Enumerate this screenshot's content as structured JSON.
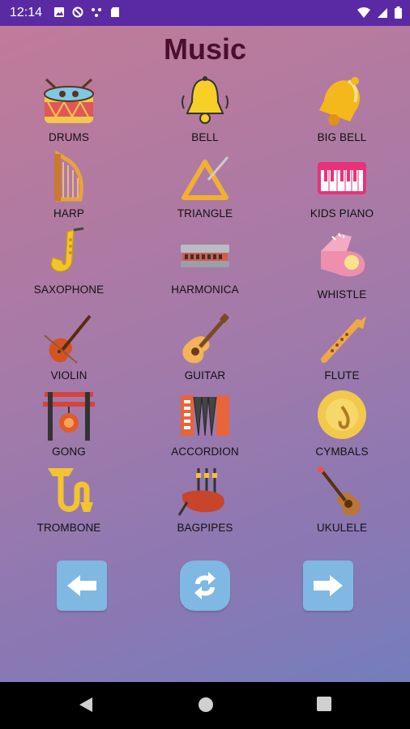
{
  "status_bar": {
    "time": "12:14"
  },
  "page_title": "Music",
  "instruments": [
    {
      "label": "DRUMS",
      "icon": "drum-icon"
    },
    {
      "label": "BELL",
      "icon": "bell-icon"
    },
    {
      "label": "BIG BELL",
      "icon": "big-bell-icon"
    },
    {
      "label": "HARP",
      "icon": "harp-icon"
    },
    {
      "label": "TRIANGLE",
      "icon": "triangle-icon"
    },
    {
      "label": "KIDS PIANO",
      "icon": "kids-piano-icon"
    },
    {
      "label": "SAXOPHONE",
      "icon": "saxophone-icon"
    },
    {
      "label": "HARMONICA",
      "icon": "harmonica-icon"
    },
    {
      "label": "WHISTLE",
      "icon": "whistle-icon"
    },
    {
      "label": "VIOLIN",
      "icon": "violin-icon"
    },
    {
      "label": "GUITAR",
      "icon": "guitar-icon"
    },
    {
      "label": "FLUTE",
      "icon": "flute-icon"
    },
    {
      "label": "GONG",
      "icon": "gong-icon"
    },
    {
      "label": "ACCORDION",
      "icon": "accordion-icon"
    },
    {
      "label": "CYMBALS",
      "icon": "cymbals-icon"
    },
    {
      "label": "TROMBONE",
      "icon": "trombone-icon"
    },
    {
      "label": "BAGPIPES",
      "icon": "bagpipes-icon"
    },
    {
      "label": "UKULELE",
      "icon": "ukulele-icon"
    }
  ],
  "controls": {
    "prev": "arrow-left-icon",
    "refresh": "refresh-icon",
    "next": "arrow-right-icon"
  },
  "colors": {
    "status_bar": "#5a2aa4",
    "title": "#4a0f2e",
    "button": "#7fb8e3"
  }
}
